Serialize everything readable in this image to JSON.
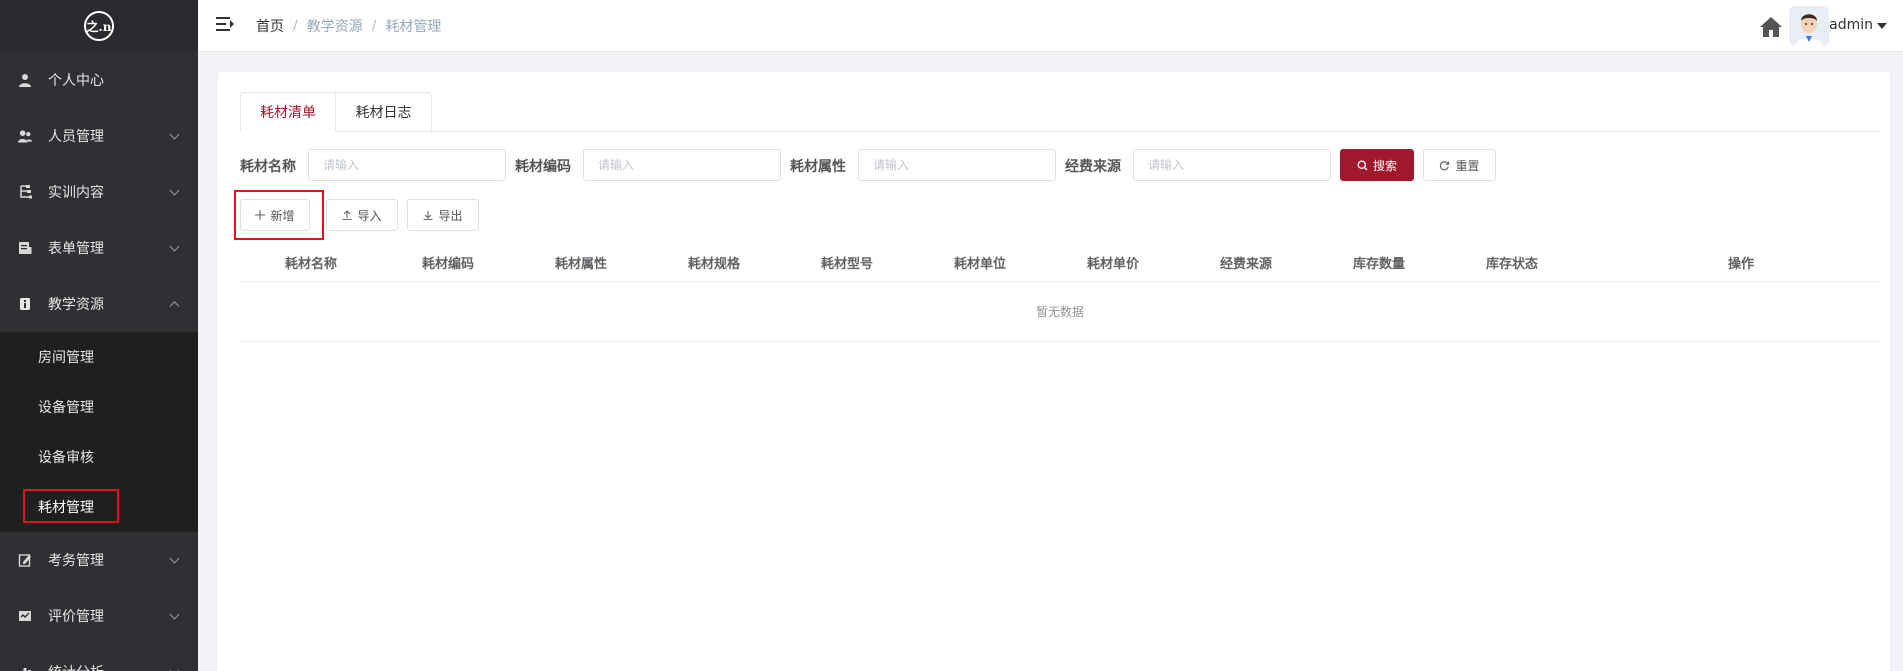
{
  "sidebar": {
    "logo_text": "之.n",
    "items": [
      {
        "label": "个人中心",
        "icon": "user-icon",
        "expandable": false
      },
      {
        "label": "人员管理",
        "icon": "users-icon",
        "expandable": true
      },
      {
        "label": "实训内容",
        "icon": "tree-icon",
        "expandable": true
      },
      {
        "label": "表单管理",
        "icon": "form-icon",
        "expandable": true
      },
      {
        "label": "教学资源",
        "icon": "resource-icon",
        "expandable": true,
        "expanded": true
      }
    ],
    "sub_items": [
      {
        "label": "房间管理"
      },
      {
        "label": "设备管理"
      },
      {
        "label": "设备审核"
      },
      {
        "label": "耗材管理",
        "active": true
      }
    ],
    "items_after": [
      {
        "label": "考务管理",
        "icon": "edit-icon",
        "expandable": true
      },
      {
        "label": "评价管理",
        "icon": "evaluate-icon",
        "expandable": true
      },
      {
        "label": "统计分析",
        "icon": "chart-icon",
        "expandable": true
      }
    ]
  },
  "header": {
    "breadcrumb": [
      "首页",
      "教学资源",
      "耗材管理"
    ],
    "username": "admin"
  },
  "tabs": [
    "耗材清单",
    "耗材日志"
  ],
  "filters": [
    {
      "label": "耗材名称",
      "placeholder": "请输入"
    },
    {
      "label": "耗材编码",
      "placeholder": "请输入"
    },
    {
      "label": "耗材属性",
      "placeholder": "请输入"
    },
    {
      "label": "经费来源",
      "placeholder": "请输入"
    }
  ],
  "buttons": {
    "search": "搜索",
    "reset": "重置",
    "add": "新增",
    "import": "导入",
    "export": "导出"
  },
  "table": {
    "columns": [
      "耗材名称",
      "耗材编码",
      "耗材属性",
      "耗材规格",
      "耗材型号",
      "耗材单位",
      "耗材单价",
      "经费来源",
      "库存数量",
      "库存状态",
      "操作"
    ],
    "empty_text": "暂无数据"
  },
  "colors": {
    "accent": "#a0182c",
    "sidebar_bg": "#2f3033",
    "highlight_box": "#e0141e"
  }
}
